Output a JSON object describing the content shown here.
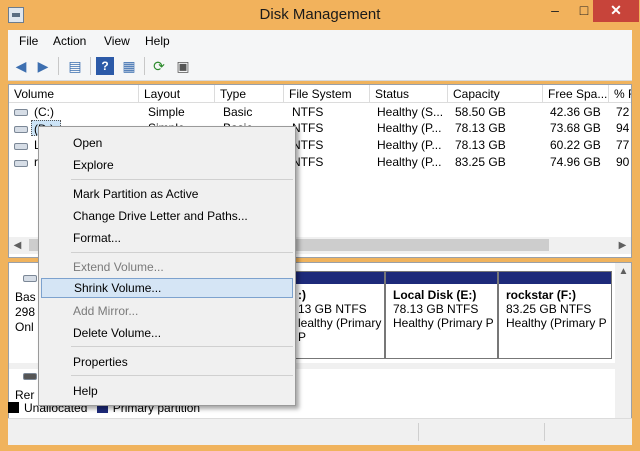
{
  "window": {
    "title": "Disk Management",
    "controls": {
      "minimize": "–",
      "maximize": "□",
      "close": "✕"
    }
  },
  "menu": [
    "File",
    "Action",
    "View",
    "Help"
  ],
  "toolbar": {
    "icons": [
      "back-arrow-icon",
      "forward-arrow-icon",
      "console-tree-icon",
      "help-icon",
      "properties-icon",
      "refresh-icon",
      "rescan-icon"
    ]
  },
  "volume_table": {
    "columns": [
      "Volume",
      "Layout",
      "Type",
      "File System",
      "Status",
      "Capacity",
      "Free Spa...",
      "% F"
    ],
    "rows": [
      {
        "volume": "(C:)",
        "layout": "Simple",
        "type": "Basic",
        "fs": "NTFS",
        "status": "Healthy (S...",
        "capacity": "58.50 GB",
        "free": "42.36 GB",
        "pct": "72"
      },
      {
        "volume": "(D:)",
        "layout": "Simple",
        "type": "Basic",
        "fs": "NTFS",
        "status": "Healthy (P...",
        "capacity": "78.13 GB",
        "free": "73.68 GB",
        "pct": "94"
      },
      {
        "volume": "L",
        "layout": "",
        "type": "",
        "fs": "NTFS",
        "status": "Healthy (P...",
        "capacity": "78.13 GB",
        "free": "60.22 GB",
        "pct": "77"
      },
      {
        "volume": "ro",
        "layout": "",
        "type": "",
        "fs": "NTFS",
        "status": "Healthy (P...",
        "capacity": "83.25 GB",
        "free": "74.96 GB",
        "pct": "90"
      }
    ]
  },
  "disk_view": {
    "disk_label": [
      "Bas",
      "298",
      "Onl"
    ],
    "removable_label": "Rer",
    "partitions": [
      {
        "name": "",
        "line1": ":)",
        "line2": "13 GB NTFS",
        "line3": "lealthy (Primary P"
      },
      {
        "name": "Local Disk  (E:)",
        "line1": "",
        "line2": "78.13 GB NTFS",
        "line3": "Healthy (Primary P"
      },
      {
        "name": "rockstar  (F:)",
        "line1": "",
        "line2": "83.25 GB NTFS",
        "line3": "Healthy (Primary P"
      }
    ]
  },
  "legend": [
    {
      "label": "Unallocated",
      "color": "#000000"
    },
    {
      "label": "Primary partition",
      "color": "#1d2a7a"
    }
  ],
  "context_menu": {
    "items": [
      {
        "label": "Open",
        "enabled": true
      },
      {
        "label": "Explore",
        "enabled": true
      },
      {
        "label": "Mark Partition as Active",
        "enabled": true
      },
      {
        "label": "Change Drive Letter and Paths...",
        "enabled": true
      },
      {
        "label": "Format...",
        "enabled": true
      },
      {
        "label": "Extend Volume...",
        "enabled": false
      },
      {
        "label": "Shrink Volume...",
        "enabled": true,
        "highlighted": true
      },
      {
        "label": "Add Mirror...",
        "enabled": false
      },
      {
        "label": "Delete Volume...",
        "enabled": true
      },
      {
        "label": "Properties",
        "enabled": true
      },
      {
        "label": "Help",
        "enabled": true
      }
    ]
  }
}
